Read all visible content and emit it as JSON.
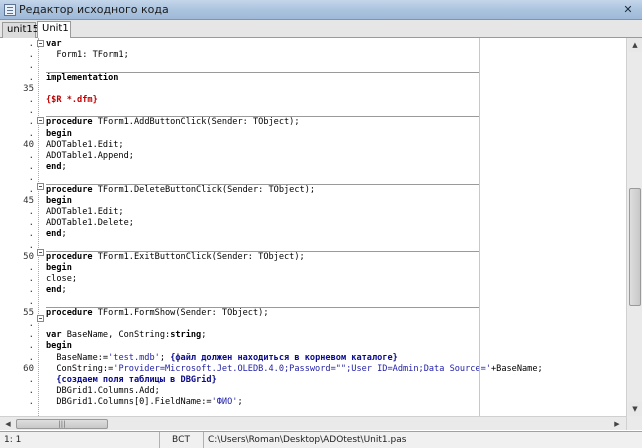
{
  "window": {
    "title": "Редактор исходного кода",
    "close_label": "✕"
  },
  "tabs": [
    {
      "label": "unit15"
    },
    {
      "label": "Unit1"
    }
  ],
  "gutter": [
    {
      "text": "."
    },
    {
      "text": "."
    },
    {
      "text": "."
    },
    {
      "text": "."
    },
    {
      "text": "35"
    },
    {
      "text": "."
    },
    {
      "text": "."
    },
    {
      "text": "."
    },
    {
      "text": "."
    },
    {
      "text": "40"
    },
    {
      "text": "."
    },
    {
      "text": "."
    },
    {
      "text": "."
    },
    {
      "text": "."
    },
    {
      "text": "45"
    },
    {
      "text": "."
    },
    {
      "text": "."
    },
    {
      "text": "."
    },
    {
      "text": "."
    },
    {
      "text": "50"
    },
    {
      "text": "."
    },
    {
      "text": "."
    },
    {
      "text": "."
    },
    {
      "text": "."
    },
    {
      "text": "55"
    },
    {
      "text": "."
    },
    {
      "text": "."
    },
    {
      "text": "."
    },
    {
      "text": "."
    },
    {
      "text": "60"
    },
    {
      "text": "."
    },
    {
      "text": "."
    },
    {
      "text": "."
    }
  ],
  "code": [
    [
      {
        "t": "var",
        "c": "kw"
      }
    ],
    [
      {
        "t": "  Form1: TForm1;",
        "c": ""
      }
    ],
    [],
    [
      {
        "t": "implementation",
        "c": "kw"
      }
    ],
    [],
    [
      {
        "t": "{$R *.dfm}",
        "c": "dir"
      }
    ],
    [],
    [
      {
        "t": "procedure",
        "c": "kw"
      },
      {
        "t": " TForm1.AddButtonClick(Sender: TObject);",
        "c": ""
      }
    ],
    [
      {
        "t": "begin",
        "c": "kw"
      }
    ],
    [
      {
        "t": "ADOTable1.Edit;",
        "c": ""
      }
    ],
    [
      {
        "t": "ADOTable1.Append;",
        "c": ""
      }
    ],
    [
      {
        "t": "end",
        "c": "kw"
      },
      {
        "t": ";",
        "c": ""
      }
    ],
    [],
    [
      {
        "t": "procedure",
        "c": "kw"
      },
      {
        "t": " TForm1.DeleteButtonClick(Sender: TObject);",
        "c": ""
      }
    ],
    [
      {
        "t": "begin",
        "c": "kw"
      }
    ],
    [
      {
        "t": "ADOTable1.Edit;",
        "c": ""
      }
    ],
    [
      {
        "t": "ADOTable1.Delete;",
        "c": ""
      }
    ],
    [
      {
        "t": "end",
        "c": "kw"
      },
      {
        "t": ";",
        "c": ""
      }
    ],
    [],
    [
      {
        "t": "procedure",
        "c": "kw"
      },
      {
        "t": " TForm1.ExitButtonClick(Sender: TObject);",
        "c": ""
      }
    ],
    [
      {
        "t": "begin",
        "c": "kw"
      }
    ],
    [
      {
        "t": "close;",
        "c": ""
      }
    ],
    [
      {
        "t": "end",
        "c": "kw"
      },
      {
        "t": ";",
        "c": ""
      }
    ],
    [],
    [
      {
        "t": "procedure",
        "c": "kw"
      },
      {
        "t": " TForm1.FormShow(Sender: TObject);",
        "c": ""
      }
    ],
    [],
    [
      {
        "t": "var",
        "c": "kw"
      },
      {
        "t": " BaseName, ConString:",
        "c": ""
      },
      {
        "t": "string",
        "c": "kw"
      },
      {
        "t": ";",
        "c": ""
      }
    ],
    [
      {
        "t": "begin",
        "c": "kw"
      }
    ],
    [
      {
        "t": "  BaseName:=",
        "c": ""
      },
      {
        "t": "'test.mdb'",
        "c": "str"
      },
      {
        "t": "; ",
        "c": ""
      },
      {
        "t": "{файл должен находиться в корневом каталоге}",
        "c": "cmt"
      }
    ],
    [
      {
        "t": "  ConString:=",
        "c": ""
      },
      {
        "t": "'Provider=Microsoft.Jet.OLEDB.4.0;Password=\"\";User ID=Admin;Data Source='",
        "c": "str"
      },
      {
        "t": "+BaseName;",
        "c": ""
      }
    ],
    [
      {
        "t": "  {создаем поля таблицы в DBGrid}",
        "c": "cmt"
      }
    ],
    [
      {
        "t": "  DBGrid1.Columns.Add;",
        "c": ""
      }
    ],
    [
      {
        "t": "  DBGrid1.Columns[0].FieldName:=",
        "c": ""
      },
      {
        "t": "'ФИО'",
        "c": "str"
      },
      {
        "t": ";",
        "c": ""
      }
    ]
  ],
  "status": {
    "position": "1: 1",
    "mode": "ВСТ",
    "path": "C:\\Users\\Roman\\Desktop\\ADOtest\\Unit1.pas"
  },
  "scrollbars": {
    "up": "▲",
    "down": "▼",
    "left": "◀",
    "right": "▶",
    "grip": "|||"
  }
}
